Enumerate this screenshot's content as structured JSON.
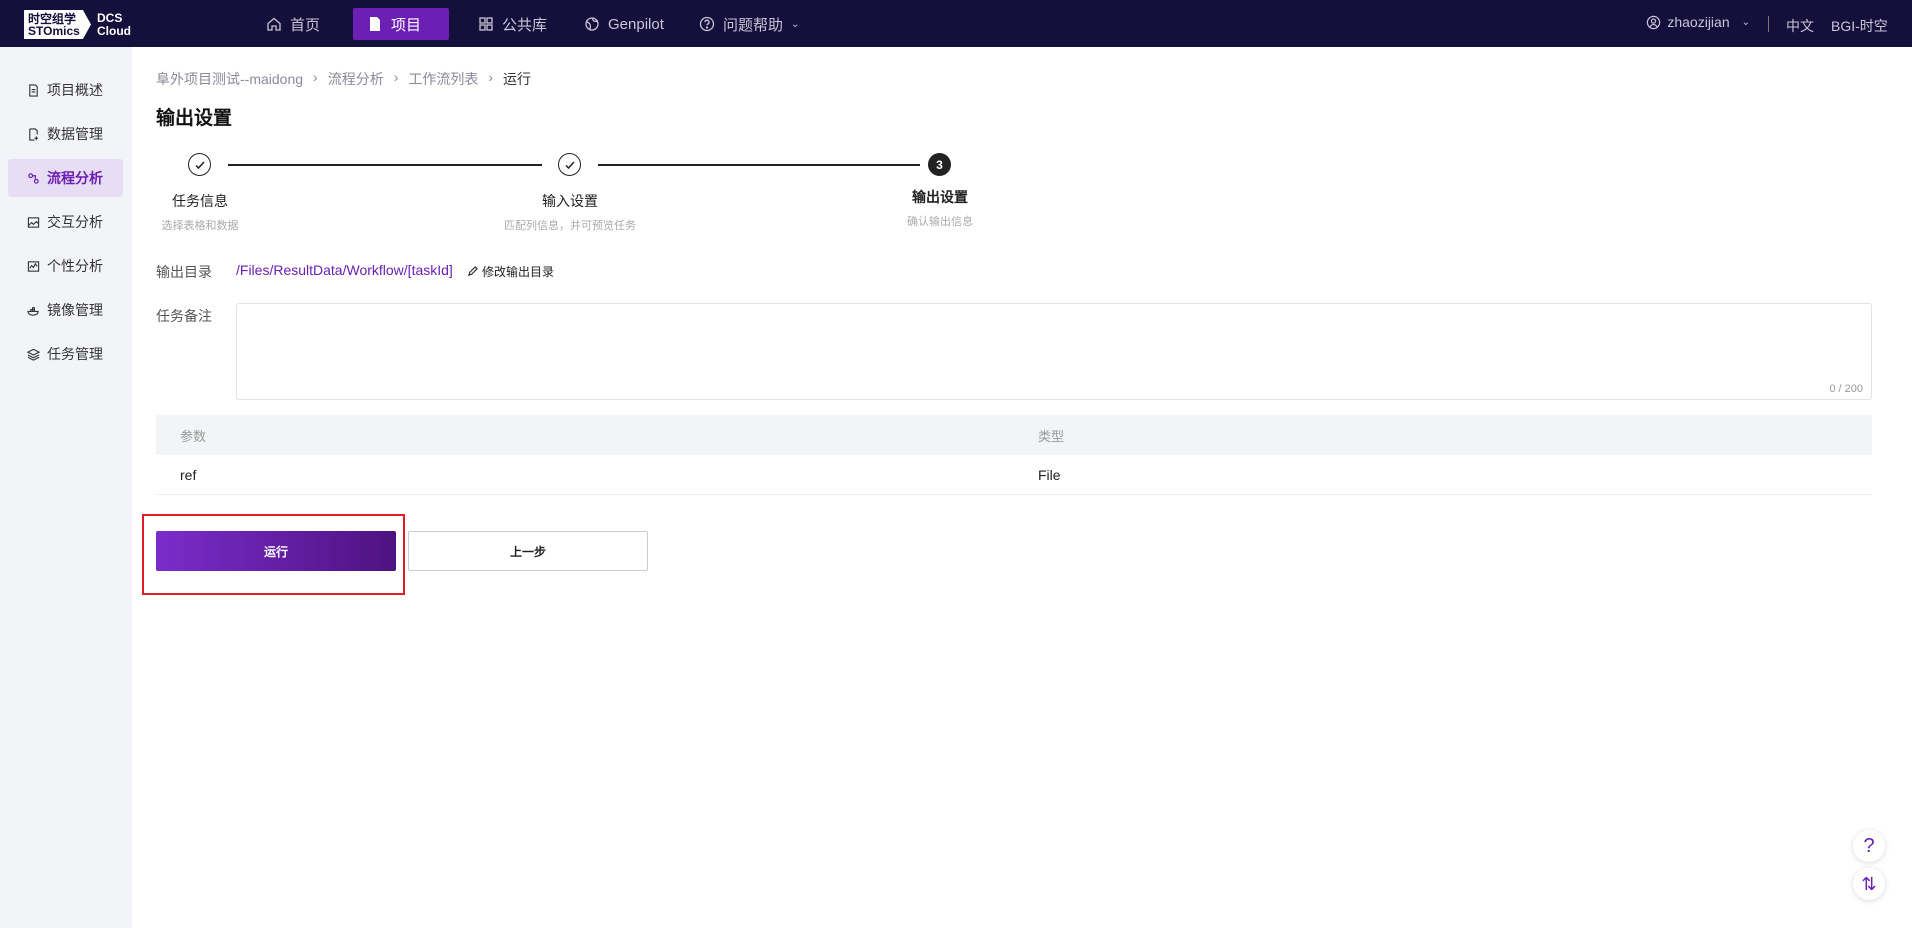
{
  "brand": {
    "logo_cn": "时空组学",
    "logo_en": "STOmics",
    "product": "DCS",
    "product2": "Cloud"
  },
  "nav": [
    {
      "label": "首页",
      "icon": "home-icon"
    },
    {
      "label": "项目",
      "icon": "document-icon",
      "active": true
    },
    {
      "label": "公共库",
      "icon": "grid-icon"
    },
    {
      "label": "Genpilot",
      "icon": "globe-icon"
    },
    {
      "label": "问题帮助",
      "icon": "help-icon"
    }
  ],
  "user": {
    "name": "zhaozijian",
    "lang": "中文",
    "org": "BGI-时空"
  },
  "sidebar": [
    {
      "label": "项目概述"
    },
    {
      "label": "数据管理"
    },
    {
      "label": "流程分析",
      "active": true
    },
    {
      "label": "交互分析"
    },
    {
      "label": "个性分析"
    },
    {
      "label": "镜像管理"
    },
    {
      "label": "任务管理"
    }
  ],
  "breadcrumb": [
    "阜外项目测试--maidong",
    "流程分析",
    "工作流列表",
    "运行"
  ],
  "page_title": "输出设置",
  "steps": [
    {
      "title": "任务信息",
      "desc": "选择表格和数据"
    },
    {
      "title": "输入设置",
      "desc": "匹配列信息，并可预览任务"
    },
    {
      "title": "输出设置",
      "desc": "确认输出信息",
      "number": "3"
    }
  ],
  "output": {
    "label": "输出目录",
    "path": "/Files/ResultData/Workflow/[taskId]",
    "edit": "修改输出目录"
  },
  "remark": {
    "label": "任务备注",
    "counter": "0 / 200"
  },
  "table": {
    "headers": [
      "参数",
      "类型"
    ],
    "rows": [
      [
        "ref",
        "File"
      ]
    ]
  },
  "buttons": {
    "run": "运行",
    "prev": "上一步"
  },
  "float": {
    "help": "?",
    "sort": "⇅"
  }
}
